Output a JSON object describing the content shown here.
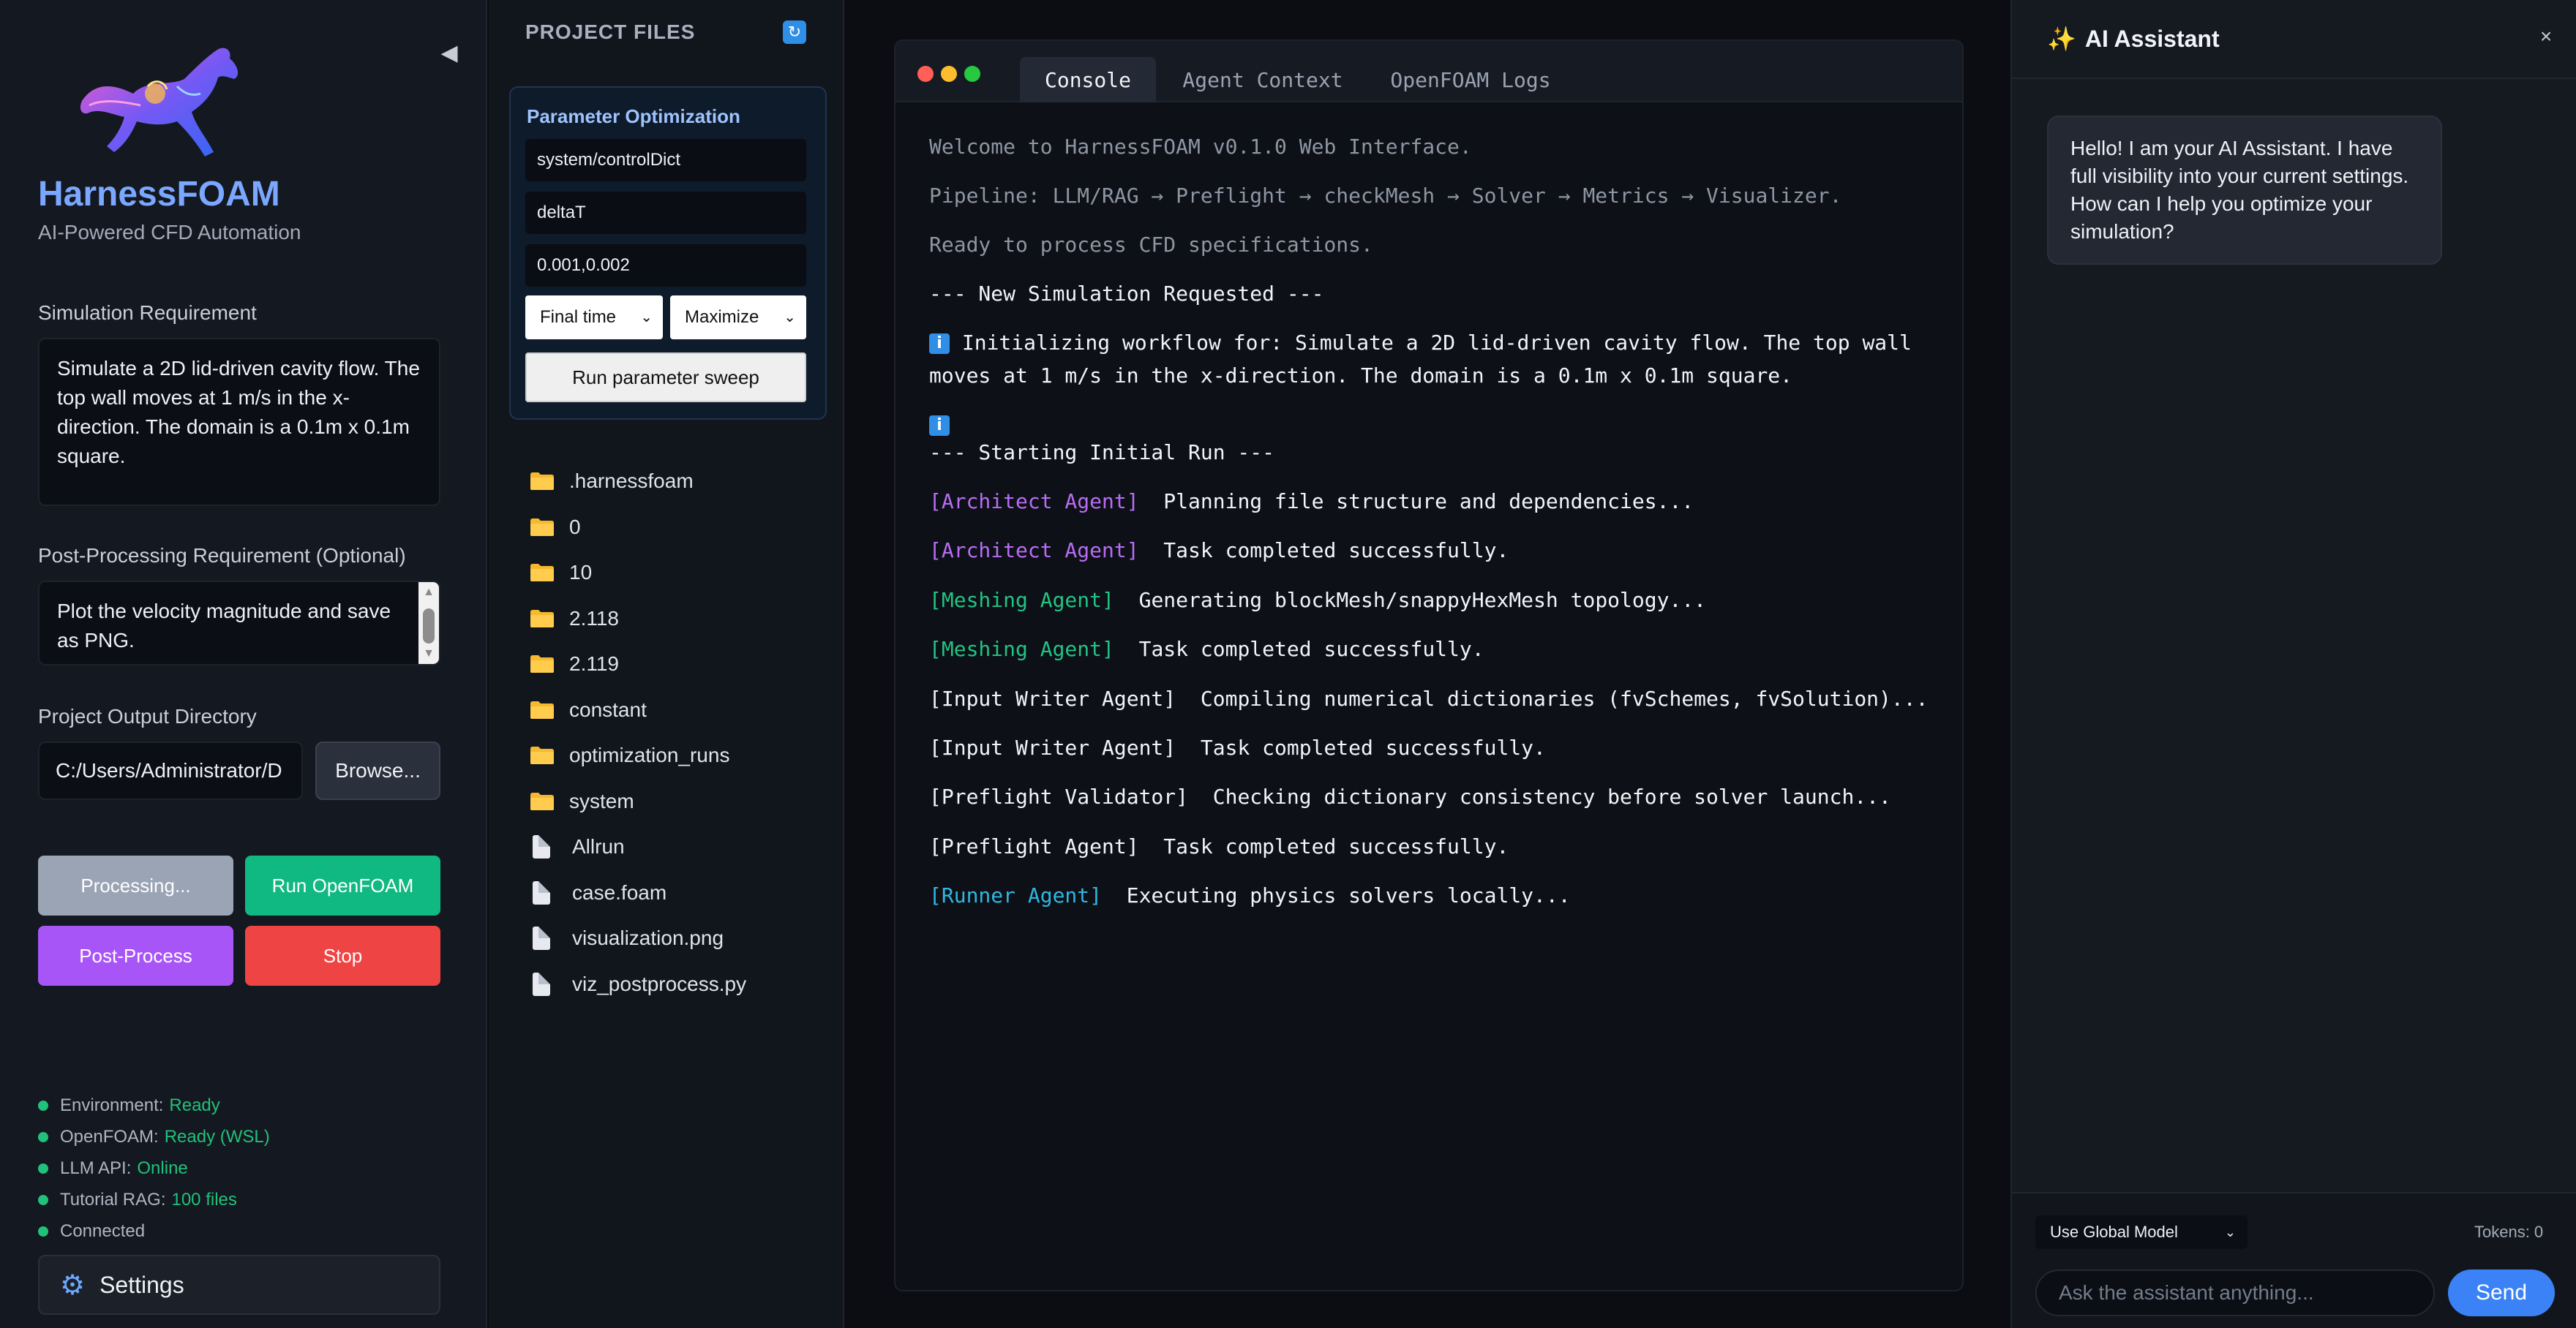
{
  "sidebar": {
    "app_title": "HarnessFOAM",
    "app_subtitle": "AI-Powered CFD Automation",
    "collapse_icon": "◀",
    "sim_req_label": "Simulation Requirement",
    "sim_req_value": "Simulate a 2D lid-driven cavity flow. The top wall moves at 1 m/s in the x-direction. The domain is a 0.1m x 0.1m square.",
    "post_req_label": "Post-Processing Requirement (Optional)",
    "post_req_value": "Plot the velocity magnitude and save as PNG.",
    "output_dir_label": "Project Output Directory",
    "output_dir_value": "C:/Users/Administrator/D",
    "browse_label": "Browse...",
    "buttons": {
      "processing": "Processing...",
      "run_openfoam": "Run OpenFOAM",
      "post_process": "Post-Process",
      "stop": "Stop"
    },
    "button_colors": {
      "processing": "#9aa4b4",
      "run_openfoam": "#10b981",
      "post_process": "#a855f7",
      "stop": "#ef4444"
    },
    "status": [
      {
        "label": "Environment:",
        "value": "Ready"
      },
      {
        "label": "OpenFOAM:",
        "value": "Ready (WSL)"
      },
      {
        "label": "LLM API:",
        "value": "Online"
      },
      {
        "label": "Tutorial RAG:",
        "value": "100 files"
      },
      {
        "label": "Connected",
        "value": ""
      }
    ],
    "settings_label": "Settings",
    "settings_icon": "gear-icon"
  },
  "files": {
    "title": "PROJECT FILES",
    "refresh_icon": "🔄",
    "optimization": {
      "title": "Parameter Optimization",
      "file_value": "system/controlDict",
      "param_value": "deltaT",
      "range_value": "0.001,0.002",
      "metric_select": "Final time",
      "goal_select": "Maximize",
      "sweep_label": "Run parameter sweep"
    },
    "items": [
      {
        "name": ".harnessfoam",
        "type": "folder"
      },
      {
        "name": "0",
        "type": "folder"
      },
      {
        "name": "10",
        "type": "folder"
      },
      {
        "name": "2.118",
        "type": "folder"
      },
      {
        "name": "2.119",
        "type": "folder"
      },
      {
        "name": "constant",
        "type": "folder"
      },
      {
        "name": "optimization_runs",
        "type": "folder"
      },
      {
        "name": "system",
        "type": "folder"
      },
      {
        "name": "Allrun",
        "type": "file"
      },
      {
        "name": "case.foam",
        "type": "file"
      },
      {
        "name": "visualization.png",
        "type": "file"
      },
      {
        "name": "viz_postprocess.py",
        "type": "file"
      }
    ]
  },
  "console": {
    "tabs": [
      "Console",
      "Agent Context",
      "OpenFOAM Logs"
    ],
    "active_tab": "Console",
    "lines": {
      "welcome": "Welcome to HarnessFOAM v0.1.0 Web Interface.",
      "pipeline": "Pipeline: LLM/RAG → Preflight → checkMesh → Solver → Metrics → Visualizer.",
      "ready": "Ready to process CFD specifications.",
      "new_sim": "--- New Simulation Requested ---",
      "init_1": "Initializing workflow for: Simulate a 2D lid-driven cavity flow. The top wall",
      "init_2": "moves at 1 m/s in the x-direction. The domain is a 0.1m x 0.1m square.",
      "starting": "--- Starting Initial Run ---",
      "info_icon": "i"
    },
    "agent_lines": [
      {
        "tag": "[Architect Agent]",
        "msg": "Planning file structure and dependencies...",
        "color": "purple"
      },
      {
        "tag": "[Architect Agent]",
        "msg": "Task completed successfully.",
        "color": "purple"
      },
      {
        "tag": "[Meshing Agent]",
        "msg": "Generating blockMesh/snappyHexMesh topology...",
        "color": "green"
      },
      {
        "tag": "[Meshing Agent]",
        "msg": "Task completed successfully.",
        "color": "green"
      },
      {
        "tag": "[Input Writer Agent]",
        "msg": "Compiling numerical dictionaries (fvSchemes, fvSolution)...",
        "color": "white"
      },
      {
        "tag": "[Input Writer Agent]",
        "msg": "Task completed successfully.",
        "color": "white"
      },
      {
        "tag": "[Preflight Validator]",
        "msg": "Checking dictionary consistency before solver launch...",
        "color": "white"
      },
      {
        "tag": "[Preflight Agent]",
        "msg": "Task completed successfully.",
        "color": "white"
      },
      {
        "tag": "[Runner Agent]",
        "msg": "Executing physics solvers locally...",
        "color": "cyan"
      }
    ]
  },
  "assistant": {
    "title": "AI Assistant",
    "sparkle_icon": "✨",
    "close_icon": "×",
    "greeting": "Hello! I am your AI Assistant. I have full visibility into your current settings. How can I help you optimize your simulation?",
    "model_select": "Use Global Model",
    "tokens": "Tokens: 0",
    "input_placeholder": "Ask the assistant anything...",
    "send_label": "Send"
  }
}
